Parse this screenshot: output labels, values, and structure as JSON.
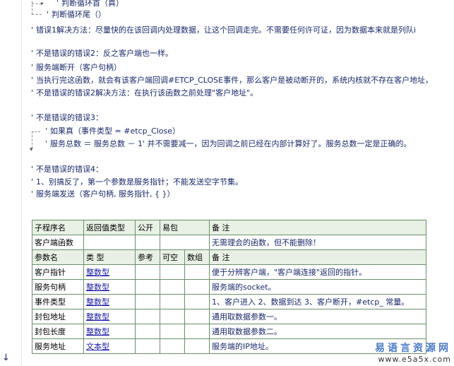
{
  "code_lines": [
    "判断循环首（真）",
    "判断循环尾（）",
    "错误1解决方法：尽量快的在该回调内处理数据，让这个回调走完。不需要任何许可证，因为数据本来就是列队i",
    "不是错误的错误2：反之客户端也一样。",
    "服务端断开（客户句柄）",
    "当执行完这函数，就会有该客户端回调#ETCP_CLOSE事件，那么客户是被动断开的，系统内核就不存在客户地址，",
    "不是错误的错误2解决方法：在执行该函数之前处理\"客户地址\"。",
    "不是错误的错误3：",
    "如果真（事件类型 = #etcp_Close）",
    "服务总数 ＝ 服务总数 － 1' 并不需要减一，因为回调之前已经在内部计算好了。服务总数一定是正确的。",
    "不是错误的错误4：",
    "1、别搞反了，第一个参数是服务指针；不能发送空字节集。",
    "服务端发送（客户句柄, 服务指针, {  }）"
  ],
  "comment_mark": "'",
  "sub_table": {
    "header": [
      "子程序名",
      "返回值类型",
      "公开",
      "易包",
      "备 注"
    ],
    "sub": {
      "name": "客户端函数",
      "return_type": "",
      "public": "",
      "epkg": "",
      "note": "无需理会的函数，但不能删除！"
    },
    "param_header": [
      "参数名",
      "类 型",
      "参考",
      "可空",
      "数组",
      "备 注"
    ],
    "params": [
      {
        "name": "客户指针",
        "type": "整数型",
        "note": "便于分辨客户端，\"客户端连接\"返回的指针。"
      },
      {
        "name": "服务句柄",
        "type": "整数型",
        "note": "服务端的socket。"
      },
      {
        "name": "事件类型",
        "type": "整数型",
        "note": "1、客户进入 2、数据到达 3、客户断开，#etcp_ 常量。"
      },
      {
        "name": "封包地址",
        "type": "整数型",
        "note": "通用取数据参数一。"
      },
      {
        "name": "封包长度",
        "type": "整数型",
        "note": "通用取数据参数二。"
      },
      {
        "name": "服务地址",
        "type": "文本型",
        "note": "服务端的IP地址。"
      }
    ]
  },
  "watermark": {
    "line1": "易语言资源网",
    "line2": "www.e5a5x.com"
  }
}
